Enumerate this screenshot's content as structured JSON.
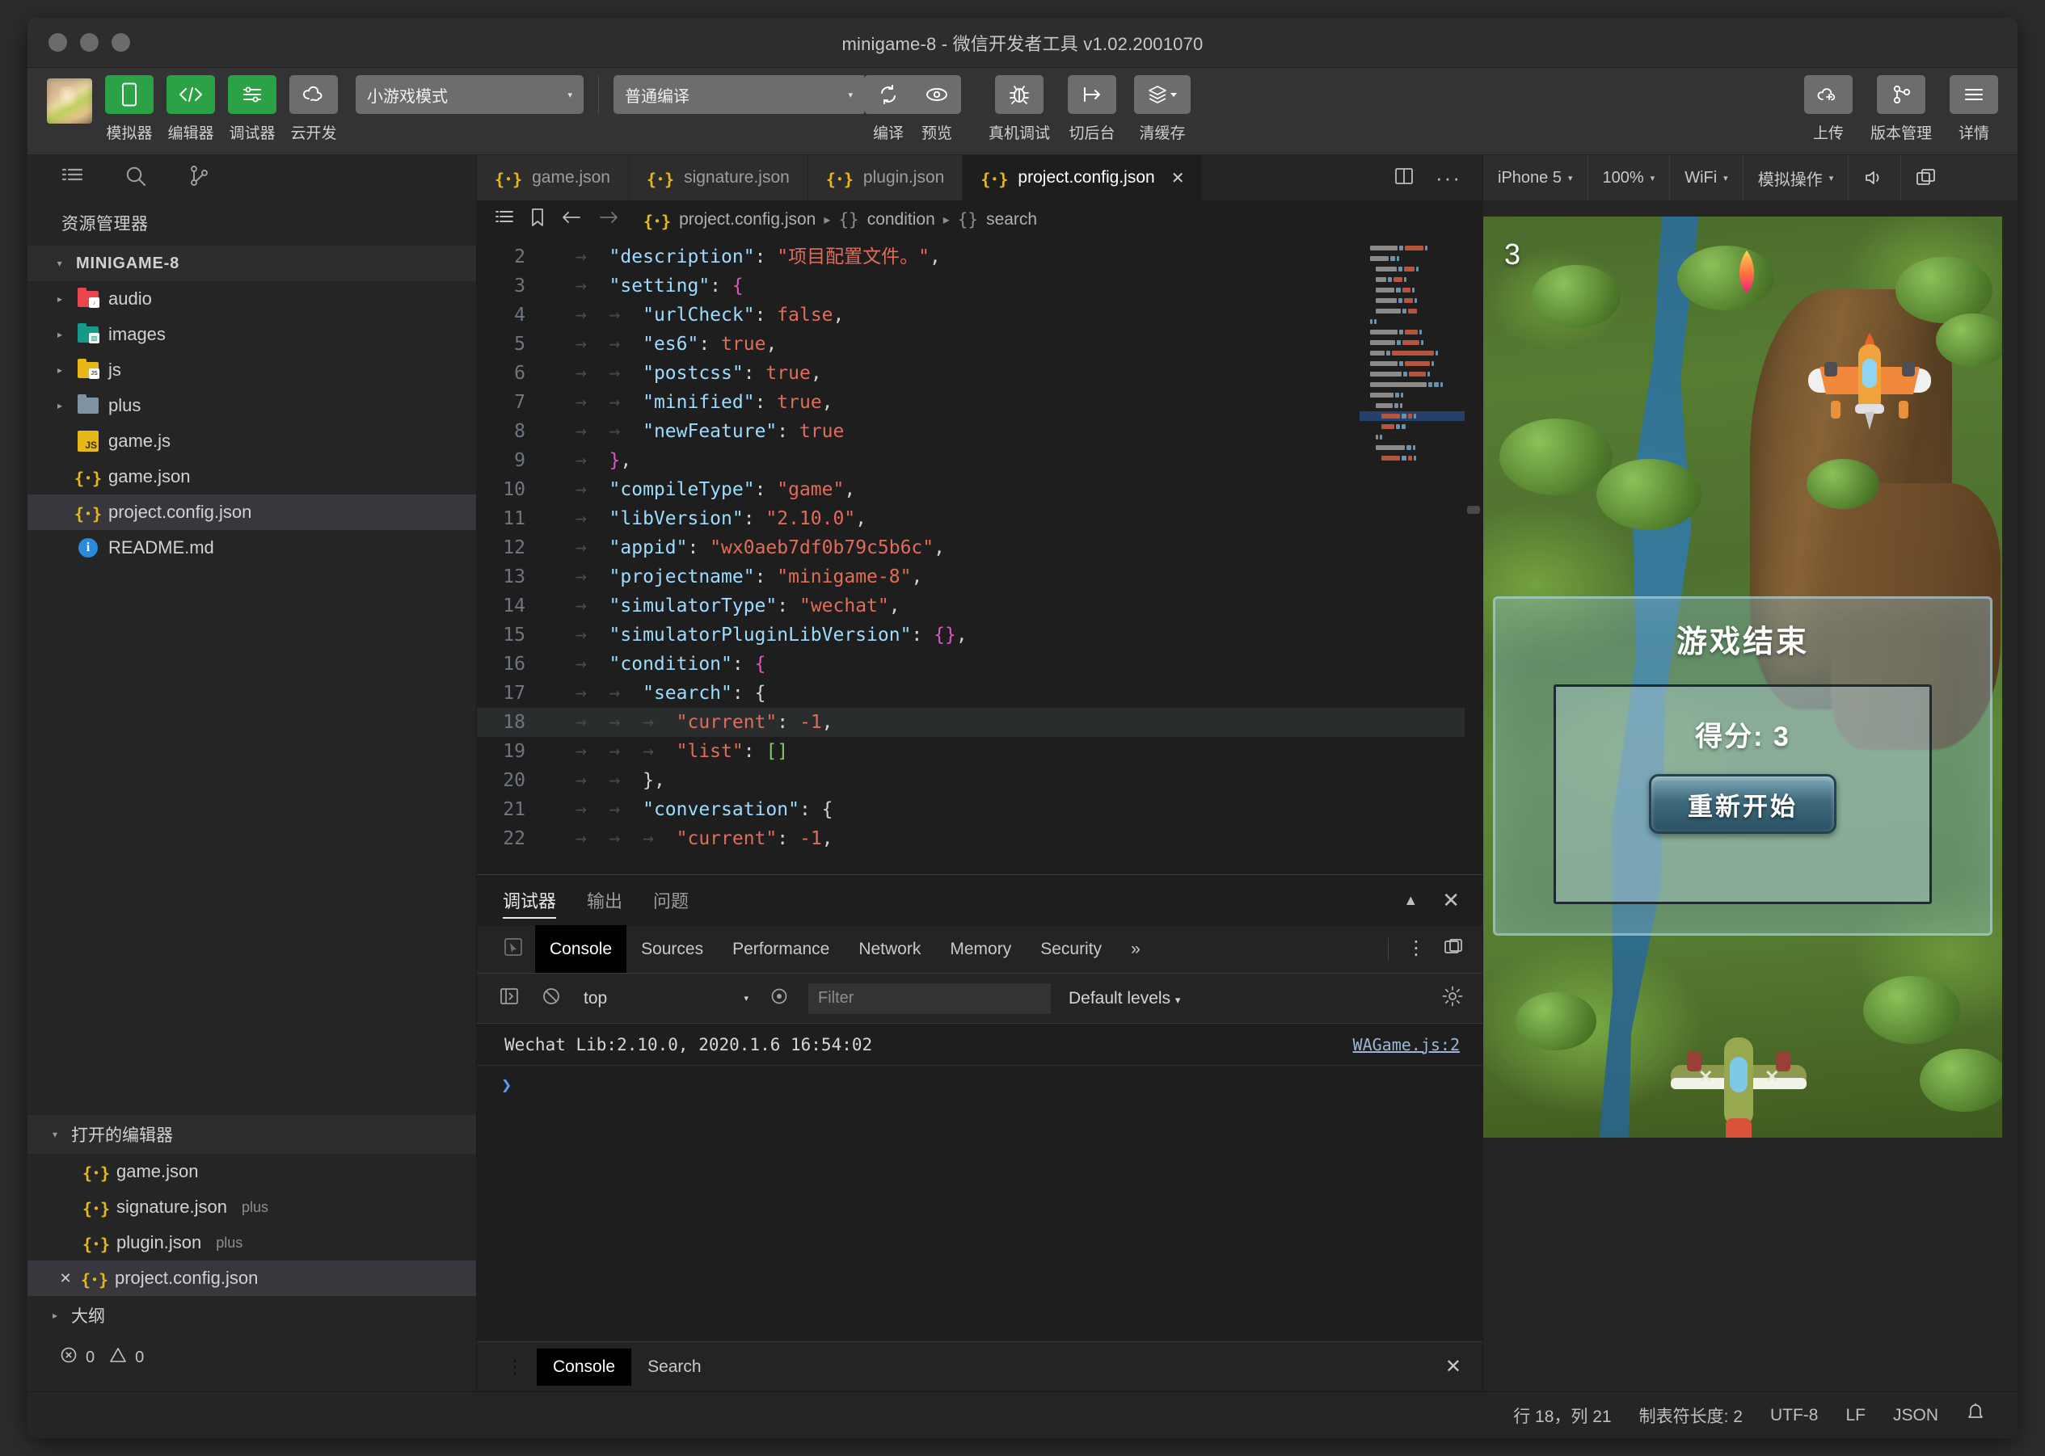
{
  "window": {
    "title": "minigame-8 - 微信开发者工具 v1.02.2001070",
    "traffic_lights": [
      "close",
      "minimize",
      "maximize"
    ]
  },
  "toolbar": {
    "avatar": "user-avatar",
    "buttons": [
      {
        "label": "模拟器",
        "icon": "phone-icon",
        "state": "active"
      },
      {
        "label": "编辑器",
        "icon": "code-icon",
        "state": "active"
      },
      {
        "label": "调试器",
        "icon": "debug-panel-icon",
        "state": "active"
      },
      {
        "label": "云开发",
        "icon": "cloud-dev-icon",
        "state": "normal"
      }
    ],
    "mode_select": {
      "value": "小游戏模式",
      "caret": "▾"
    },
    "compile_select": {
      "value": "普通编译",
      "caret": "▾"
    },
    "compile_group": [
      {
        "label": "编译",
        "icon": "refresh-icon"
      },
      {
        "label": "预览",
        "icon": "eye-icon"
      }
    ],
    "actions": [
      {
        "label": "真机调试",
        "icon": "bug-icon"
      },
      {
        "label": "切后台",
        "icon": "background-icon"
      },
      {
        "label": "清缓存",
        "icon": "layers-icon",
        "caret": "▾"
      }
    ],
    "right_actions": [
      {
        "label": "上传",
        "icon": "cloud-upload-icon"
      },
      {
        "label": "版本管理",
        "icon": "git-branch-icon"
      },
      {
        "label": "详情",
        "icon": "hamburger-icon"
      }
    ]
  },
  "activity_bar": {
    "icons": [
      "explorer-icon",
      "search-icon",
      "source-control-icon"
    ],
    "collapse_icon": "collapse-sidebar-icon"
  },
  "explorer": {
    "title": "资源管理器",
    "root": {
      "label": "MINIGAME-8",
      "expanded": true
    },
    "items": [
      {
        "label": "audio",
        "type": "folder",
        "color": "#e8464a",
        "badge": "♪",
        "expanded": false
      },
      {
        "label": "images",
        "type": "folder",
        "color": "#17998a",
        "badge": "▨",
        "expanded": false
      },
      {
        "label": "js",
        "type": "folder",
        "color": "#e8b818",
        "badge": "JS",
        "expanded": false
      },
      {
        "label": "plus",
        "type": "folder",
        "color": "#7d93a3",
        "badge": "",
        "expanded": false
      },
      {
        "label": "game.js",
        "type": "js",
        "selected": false
      },
      {
        "label": "game.json",
        "type": "json",
        "selected": false
      },
      {
        "label": "project.config.json",
        "type": "json",
        "selected": true
      },
      {
        "label": "README.md",
        "type": "md",
        "selected": false
      }
    ],
    "open_editors": {
      "title": "打开的编辑器",
      "items": [
        {
          "label": "game.json",
          "suffix": "",
          "selected": false,
          "closable": false
        },
        {
          "label": "signature.json",
          "suffix": "plus",
          "selected": false,
          "closable": false
        },
        {
          "label": "plugin.json",
          "suffix": "plus",
          "selected": false,
          "closable": false
        },
        {
          "label": "project.config.json",
          "suffix": "",
          "selected": true,
          "closable": true
        }
      ]
    },
    "outline": {
      "title": "大纲",
      "expanded": false
    },
    "problems": {
      "errors": "0",
      "warnings": "0",
      "error_icon": "error-circle-icon",
      "warning_icon": "warning-triangle-icon"
    }
  },
  "editor": {
    "tabs": [
      {
        "label": "game.json",
        "icon": "json-icon",
        "active": false
      },
      {
        "label": "signature.json",
        "icon": "json-icon",
        "active": false
      },
      {
        "label": "plugin.json",
        "icon": "json-icon",
        "active": false
      },
      {
        "label": "project.config.json",
        "icon": "json-icon",
        "active": true,
        "close": "✕"
      }
    ],
    "tab_actions": [
      "split-editor-icon",
      "more-actions-icon"
    ],
    "breadcrumb_icons": [
      "outline-icon",
      "bookmark-icon",
      "back-arrow-icon",
      "forward-arrow-icon"
    ],
    "breadcrumb": [
      {
        "icon": "json-icon",
        "label": "project.config.json"
      },
      {
        "icon": "object-icon",
        "label": "condition"
      },
      {
        "icon": "object-icon",
        "label": "search"
      }
    ],
    "lines": [
      {
        "n": "2",
        "indent": 1,
        "tokens": [
          {
            "t": "\"description\"",
            "c": "key"
          },
          {
            "t": ": ",
            "c": "punc"
          },
          {
            "t": "\"项目配置文件。\"",
            "c": "str"
          },
          {
            "t": ",",
            "c": "punc"
          }
        ]
      },
      {
        "n": "3",
        "indent": 1,
        "tokens": [
          {
            "t": "\"setting\"",
            "c": "key"
          },
          {
            "t": ": ",
            "c": "punc"
          },
          {
            "t": "{",
            "c": "brace"
          }
        ]
      },
      {
        "n": "4",
        "indent": 2,
        "tokens": [
          {
            "t": "\"urlCheck\"",
            "c": "key"
          },
          {
            "t": ": ",
            "c": "punc"
          },
          {
            "t": "false",
            "c": "bool"
          },
          {
            "t": ",",
            "c": "punc"
          }
        ]
      },
      {
        "n": "5",
        "indent": 2,
        "tokens": [
          {
            "t": "\"es6\"",
            "c": "key"
          },
          {
            "t": ": ",
            "c": "punc"
          },
          {
            "t": "true",
            "c": "bool"
          },
          {
            "t": ",",
            "c": "punc"
          }
        ]
      },
      {
        "n": "6",
        "indent": 2,
        "tokens": [
          {
            "t": "\"postcss\"",
            "c": "key"
          },
          {
            "t": ": ",
            "c": "punc"
          },
          {
            "t": "true",
            "c": "bool"
          },
          {
            "t": ",",
            "c": "punc"
          }
        ]
      },
      {
        "n": "7",
        "indent": 2,
        "tokens": [
          {
            "t": "\"minified\"",
            "c": "key"
          },
          {
            "t": ": ",
            "c": "punc"
          },
          {
            "t": "true",
            "c": "bool"
          },
          {
            "t": ",",
            "c": "punc"
          }
        ]
      },
      {
        "n": "8",
        "indent": 2,
        "tokens": [
          {
            "t": "\"newFeature\"",
            "c": "key"
          },
          {
            "t": ": ",
            "c": "punc"
          },
          {
            "t": "true",
            "c": "bool"
          }
        ]
      },
      {
        "n": "9",
        "indent": 1,
        "tokens": [
          {
            "t": "}",
            "c": "brace"
          },
          {
            "t": ",",
            "c": "punc"
          }
        ]
      },
      {
        "n": "10",
        "indent": 1,
        "tokens": [
          {
            "t": "\"compileType\"",
            "c": "key"
          },
          {
            "t": ": ",
            "c": "punc"
          },
          {
            "t": "\"game\"",
            "c": "str"
          },
          {
            "t": ",",
            "c": "punc"
          }
        ]
      },
      {
        "n": "11",
        "indent": 1,
        "tokens": [
          {
            "t": "\"libVersion\"",
            "c": "key"
          },
          {
            "t": ": ",
            "c": "punc"
          },
          {
            "t": "\"2.10.0\"",
            "c": "str"
          },
          {
            "t": ",",
            "c": "punc"
          }
        ]
      },
      {
        "n": "12",
        "indent": 1,
        "tokens": [
          {
            "t": "\"appid\"",
            "c": "key"
          },
          {
            "t": ": ",
            "c": "punc"
          },
          {
            "t": "\"wx0aeb7df0b79c5b6c\"",
            "c": "str"
          },
          {
            "t": ",",
            "c": "punc"
          }
        ]
      },
      {
        "n": "13",
        "indent": 1,
        "tokens": [
          {
            "t": "\"projectname\"",
            "c": "key"
          },
          {
            "t": ": ",
            "c": "punc"
          },
          {
            "t": "\"minigame-8\"",
            "c": "str"
          },
          {
            "t": ",",
            "c": "punc"
          }
        ]
      },
      {
        "n": "14",
        "indent": 1,
        "tokens": [
          {
            "t": "\"simulatorType\"",
            "c": "key"
          },
          {
            "t": ": ",
            "c": "punc"
          },
          {
            "t": "\"wechat\"",
            "c": "str"
          },
          {
            "t": ",",
            "c": "punc"
          }
        ]
      },
      {
        "n": "15",
        "indent": 1,
        "tokens": [
          {
            "t": "\"simulatorPluginLibVersion\"",
            "c": "key"
          },
          {
            "t": ": ",
            "c": "punc"
          },
          {
            "t": "{}",
            "c": "brace"
          },
          {
            "t": ",",
            "c": "punc"
          }
        ]
      },
      {
        "n": "16",
        "indent": 1,
        "tokens": [
          {
            "t": "\"condition\"",
            "c": "key"
          },
          {
            "t": ": ",
            "c": "punc"
          },
          {
            "t": "{",
            "c": "brace"
          }
        ]
      },
      {
        "n": "17",
        "indent": 2,
        "tokens": [
          {
            "t": "\"search\"",
            "c": "key"
          },
          {
            "t": ": ",
            "c": "punc"
          },
          {
            "t": "{",
            "c": "white"
          }
        ]
      },
      {
        "n": "18",
        "indent": 3,
        "highlight": true,
        "tokens": [
          {
            "t": "\"current\"",
            "c": "str"
          },
          {
            "t": ": ",
            "c": "punc"
          },
          {
            "t": "-1",
            "c": "num"
          },
          {
            "t": ",",
            "c": "punc"
          }
        ]
      },
      {
        "n": "19",
        "indent": 3,
        "tokens": [
          {
            "t": "\"list\"",
            "c": "str"
          },
          {
            "t": ": ",
            "c": "punc"
          },
          {
            "t": "[]",
            "c": "brk"
          }
        ]
      },
      {
        "n": "20",
        "indent": 2,
        "tokens": [
          {
            "t": "}",
            "c": "white"
          },
          {
            "t": ",",
            "c": "punc"
          }
        ]
      },
      {
        "n": "21",
        "indent": 2,
        "tokens": [
          {
            "t": "\"conversation\"",
            "c": "key"
          },
          {
            "t": ": ",
            "c": "punc"
          },
          {
            "t": "{",
            "c": "punc"
          }
        ]
      },
      {
        "n": "22",
        "indent": 3,
        "tokens": [
          {
            "t": "\"current\"",
            "c": "str"
          },
          {
            "t": ": ",
            "c": "punc"
          },
          {
            "t": "-1",
            "c": "num"
          },
          {
            "t": ",",
            "c": "punc"
          }
        ]
      }
    ]
  },
  "panel": {
    "tabs": [
      {
        "label": "调试器",
        "active": true
      },
      {
        "label": "输出",
        "active": false
      },
      {
        "label": "问题",
        "active": false
      }
    ],
    "actions": [
      "collapse-panel-icon",
      "close-panel-icon"
    ],
    "devtools_tabs": [
      {
        "label": "Console",
        "active": true
      },
      {
        "label": "Sources",
        "active": false
      },
      {
        "label": "Performance",
        "active": false
      },
      {
        "label": "Network",
        "active": false
      },
      {
        "label": "Memory",
        "active": false
      },
      {
        "label": "Security",
        "active": false
      },
      {
        "label": "»",
        "active": false
      }
    ],
    "devtools_right": [
      "more-vertical-icon",
      "dock-side-icon"
    ],
    "console_toolbar": {
      "sidebar_icon": "console-sidebar-icon",
      "clear_icon": "clear-console-icon",
      "context": "top",
      "context_caret": "▾",
      "live_expression_icon": "eye-target-icon",
      "filter_placeholder": "Filter",
      "levels": "Default levels",
      "levels_caret": "▾",
      "settings_icon": "gear-icon"
    },
    "messages": [
      {
        "text": "Wechat Lib:2.10.0, 2020.1.6 16:54:02",
        "source": "WAGame.js:2"
      }
    ],
    "prompt": "❯",
    "drawer": {
      "menu_icon": "drawer-menu-icon",
      "tabs": [
        {
          "label": "Console",
          "active": true
        },
        {
          "label": "Search",
          "active": false
        }
      ],
      "close": "✕"
    }
  },
  "simulator": {
    "controls": [
      {
        "label": "iPhone 5",
        "caret": "▾",
        "name": "device-select"
      },
      {
        "label": "100%",
        "caret": "▾",
        "name": "zoom-select"
      },
      {
        "label": "WiFi",
        "caret": "▾",
        "name": "network-select"
      },
      {
        "label": "模拟操作",
        "caret": "▾",
        "name": "simulate-action-select"
      }
    ],
    "icons": [
      "volume-icon",
      "detach-window-icon"
    ],
    "game": {
      "score_hud": "3",
      "dialog_title": "游戏结束",
      "dialog_score": "得分: 3",
      "restart_button": "重新开始"
    }
  },
  "statusbar": {
    "cursor": "行 18，列 21",
    "indent": "制表符长度: 2",
    "encoding": "UTF-8",
    "eol": "LF",
    "language": "JSON",
    "bell_icon": "bell-icon"
  },
  "colors": {
    "accent_green": "#2ba245",
    "json_yellow": "#e8b818",
    "key_blue": "#9cdcfe",
    "string_red": "#e06c5a",
    "bg_editor": "#1e1e1e",
    "bg_sidebar": "#252526"
  }
}
